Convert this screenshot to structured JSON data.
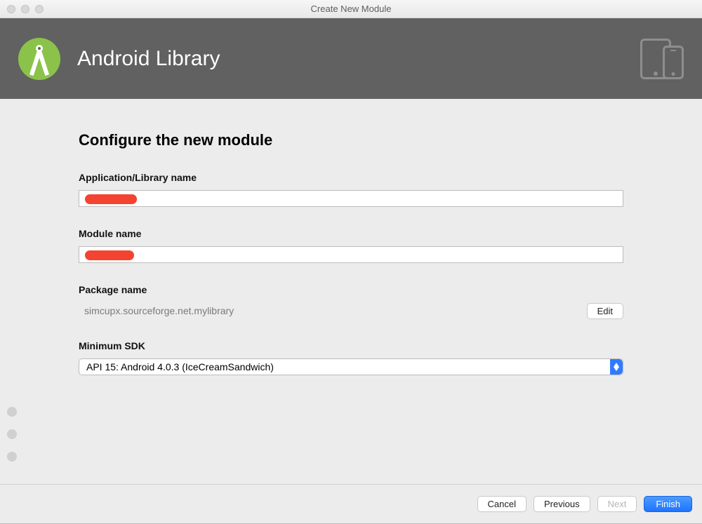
{
  "window": {
    "title": "Create New Module"
  },
  "banner": {
    "title": "Android Library"
  },
  "section": {
    "title": "Configure the new module"
  },
  "fields": {
    "appLibName": {
      "label": "Application/Library name",
      "value": ""
    },
    "moduleName": {
      "label": "Module name",
      "value": ""
    },
    "packageName": {
      "label": "Package name",
      "value": "simcupx.sourceforge.net.mylibrary",
      "editLabel": "Edit"
    },
    "minSdk": {
      "label": "Minimum SDK",
      "selected": "API 15: Android 4.0.3 (IceCreamSandwich)"
    }
  },
  "buttons": {
    "cancel": "Cancel",
    "previous": "Previous",
    "next": "Next",
    "finish": "Finish"
  }
}
